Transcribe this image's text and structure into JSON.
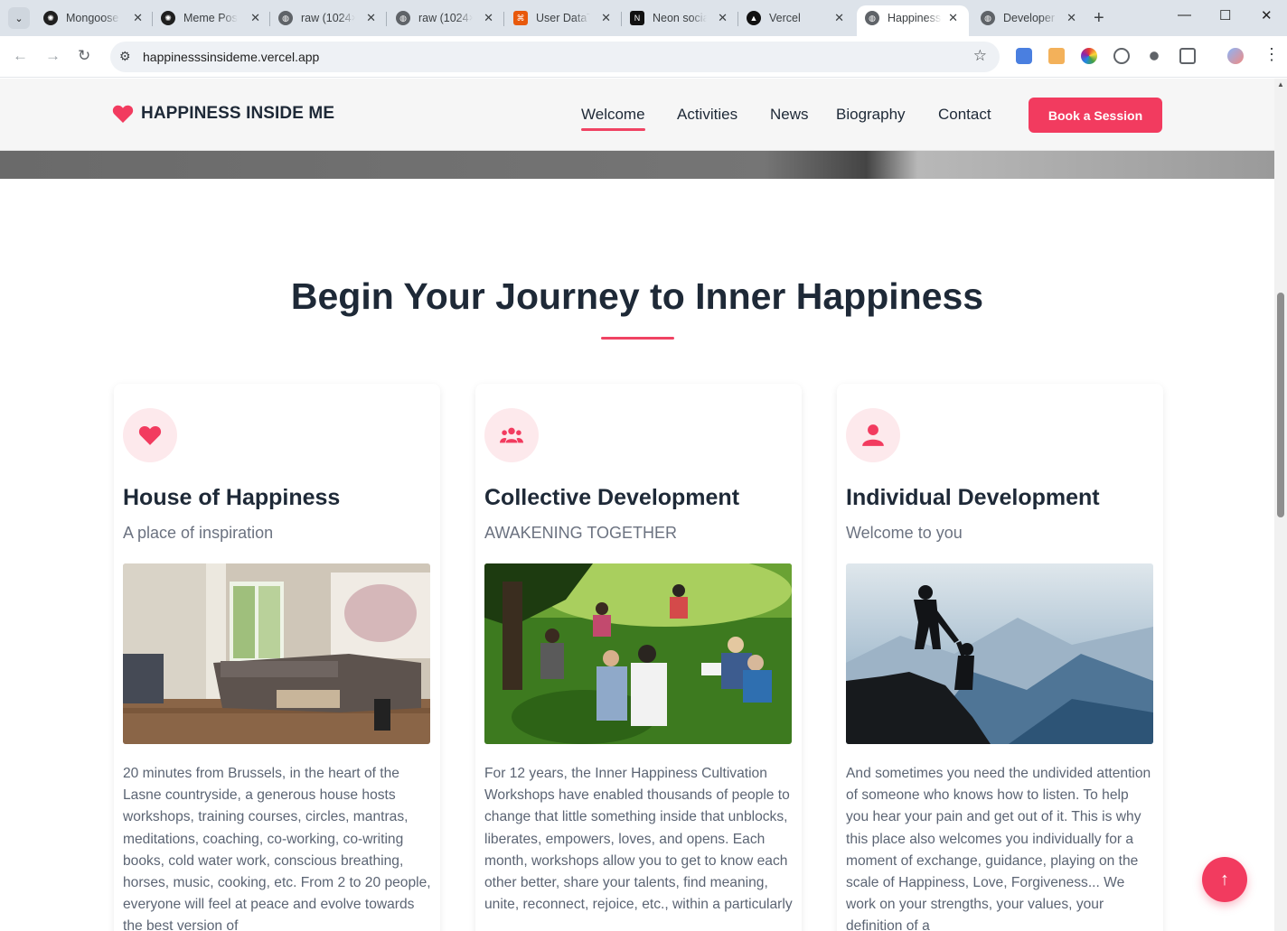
{
  "browser": {
    "tabs": [
      {
        "title": "Mongoose",
        "icon": "openai-icon",
        "color": "#1f1f1f"
      },
      {
        "title": "Meme Post",
        "icon": "openai-icon",
        "color": "#1f1f1f"
      },
      {
        "title": "raw (1024×",
        "icon": "globe-icon",
        "color": "#5f6368"
      },
      {
        "title": "raw (1024×",
        "icon": "globe-icon",
        "color": "#5f6368"
      },
      {
        "title": "User DataT",
        "icon": "postman-icon",
        "color": "#e8590c"
      },
      {
        "title": "Neon socia",
        "icon": "neon-icon",
        "color": "#111111"
      },
      {
        "title": "Vercel",
        "icon": "vercel-icon",
        "color": "#111111"
      },
      {
        "title": "Happiness",
        "icon": "globe-icon",
        "color": "#5f6368",
        "active": true
      },
      {
        "title": "Developer",
        "icon": "globe-icon",
        "color": "#5f6368"
      }
    ],
    "url": "happinesssinsideme.vercel.app"
  },
  "site": {
    "brand": "HAPPINESS INSIDE ME",
    "nav": [
      {
        "label": "Welcome",
        "active": true
      },
      {
        "label": "Activities"
      },
      {
        "label": "News"
      },
      {
        "label": "Biography"
      },
      {
        "label": "Contact"
      }
    ],
    "cta": "Book a Session",
    "accent": "#f23b5f"
  },
  "section": {
    "title": "Begin Your Journey to Inner Happiness",
    "cards": [
      {
        "icon": "heart-icon",
        "title": "House of Happiness",
        "subtitle": "A place of inspiration",
        "image": "living-room-photo",
        "text": "20 minutes from Brussels, in the heart of the Lasne countryside, a generous house hosts workshops, training courses, circles, mantras, meditations, coaching, co-working, co-writing books, cold water work, conscious breathing, horses, music, cooking, etc. From 2 to 20 people, everyone will feel at peace and evolve towards the best version of"
      },
      {
        "icon": "users-icon",
        "title": "Collective Development",
        "subtitle": "AWAKENING TOGETHER",
        "image": "group-circle-on-grass-photo",
        "text": "For 12 years, the Inner Happiness Cultivation Workshops have enabled thousands of people to change that little something inside that unblocks, liberates, empowers, loves, and opens. Each month, workshops allow you to get to know each other better, share your talents, find meaning, unite, reconnect, rejoice, etc., within a particularly"
      },
      {
        "icon": "user-icon",
        "title": "Individual Development",
        "subtitle": "Welcome to you",
        "image": "helping-hand-mountain-photo",
        "text": "And sometimes you need the undivided attention of someone who knows how to listen. To help you hear your pain and get out of it. This is why this place also welcomes you individually for a moment of exchange, guidance, playing on the scale of Happiness, Love, Forgiveness... We work on your strengths, your values, your definition of a"
      }
    ]
  }
}
